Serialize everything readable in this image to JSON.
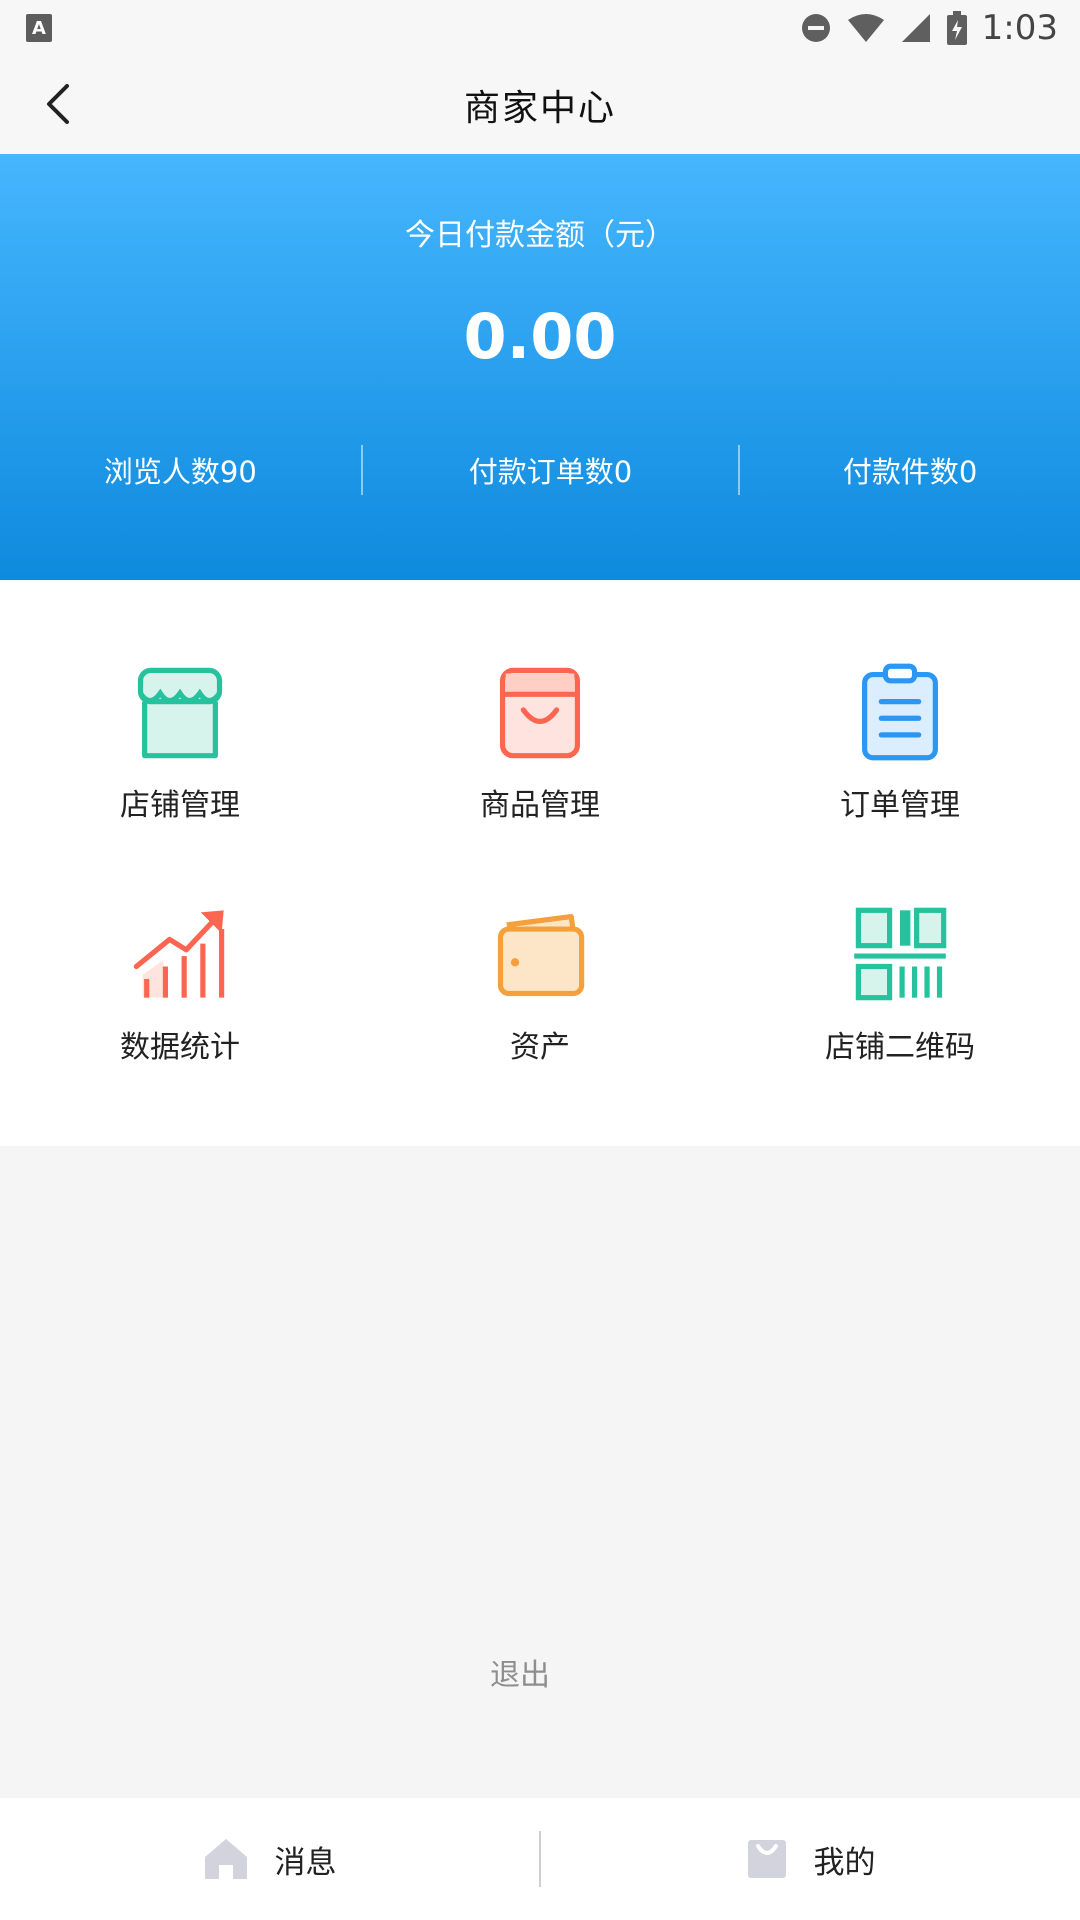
{
  "status_bar": {
    "time": "1:03",
    "notification_icon": "text-a-icon",
    "icons": [
      "do-not-disturb-icon",
      "wifi-icon",
      "signal-icon",
      "battery-charging-icon"
    ]
  },
  "nav": {
    "title": "商家中心",
    "back_icon": "chevron-left-icon"
  },
  "summary": {
    "label": "今日付款金额（元）",
    "amount": "0.00",
    "stats": {
      "views": "浏览人数90",
      "paid_orders": "付款订单数0",
      "paid_items": "付款件数0"
    }
  },
  "menu": {
    "items": [
      {
        "label": "店铺管理",
        "icon": "store-icon",
        "color": "#25c29d"
      },
      {
        "label": "商品管理",
        "icon": "shopping-bag-icon",
        "color": "#fc6650"
      },
      {
        "label": "订单管理",
        "icon": "clipboard-icon",
        "color": "#2b97f3"
      },
      {
        "label": "数据统计",
        "icon": "bar-chart-trend-icon",
        "color": "#fc6650"
      },
      {
        "label": "资产",
        "icon": "wallet-icon",
        "color": "#f5a03a"
      },
      {
        "label": "店铺二维码",
        "icon": "qr-code-icon",
        "color": "#25c29d"
      }
    ]
  },
  "logout_label": "退出",
  "tabs": [
    {
      "label": "消息",
      "icon": "home-icon"
    },
    {
      "label": "我的",
      "icon": "bag-icon"
    }
  ],
  "colors": {
    "banner_top": "#46b6fe",
    "banner_bottom": "#0e8ade",
    "page_background": "#f5f5f5"
  }
}
